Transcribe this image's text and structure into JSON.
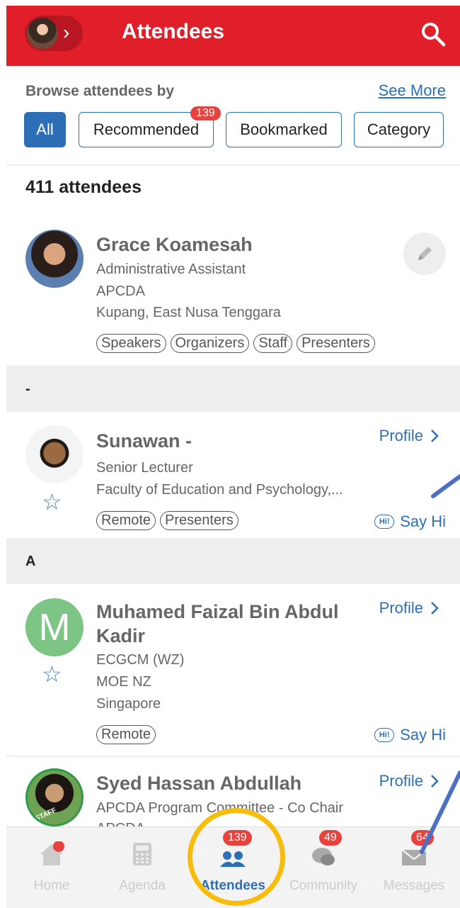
{
  "header": {
    "title": "Attendees"
  },
  "browse": {
    "label": "Browse attendees by",
    "see_more": "See More",
    "filters": [
      {
        "label": "All",
        "active": true
      },
      {
        "label": "Recommended",
        "badge": "139"
      },
      {
        "label": "Bookmarked"
      },
      {
        "label": "Category"
      }
    ]
  },
  "count_label": "411 attendees",
  "attendees": [
    {
      "name": "Grace Koamesah",
      "lines": [
        "Administrative Assistant",
        "APCDA",
        "Kupang, East Nusa Tenggara"
      ],
      "tags": [
        "Speakers",
        "Organizers",
        "Staff",
        "Presenters"
      ]
    },
    {
      "section": "-",
      "name": "Sunawan -",
      "lines": [
        "Senior Lecturer",
        "Faculty of Education and Psychology,..."
      ],
      "tags": [
        "Remote",
        "Presenters"
      ],
      "profile": "Profile",
      "say_hi": "Say Hi"
    },
    {
      "section": "A",
      "name_line1": "Muhamed Faizal Bin Abdul",
      "name_line2": "Kadir",
      "initial": "M",
      "lines": [
        "ECGCM (WZ)",
        "MOE NZ",
        "Singapore"
      ],
      "tags": [
        "Remote"
      ],
      "profile": "Profile",
      "say_hi": "Say Hi"
    },
    {
      "name": "Syed Hassan Abdullah",
      "lines": [
        "APCDA Program Committee - Co Chair",
        "APCDA"
      ],
      "photo_label": "STAFF",
      "profile": "Profile"
    }
  ],
  "hi_icon_text": "Hi!",
  "tabs": [
    {
      "label": "Home",
      "icon": "home-icon"
    },
    {
      "label": "Agenda",
      "icon": "calculator-icon"
    },
    {
      "label": "Attendees",
      "icon": "people-icon",
      "badge": "139",
      "active": true
    },
    {
      "label": "Community",
      "icon": "chat-icon",
      "badge": "49"
    },
    {
      "label": "Messages",
      "icon": "envelope-icon",
      "badge": "64"
    }
  ],
  "colors": {
    "brand_red": "#e01f2a",
    "link_blue": "#2c6fb7",
    "badge_red": "#e8423f",
    "annotation_yellow": "#f7bd0a",
    "annotation_blue": "#4a6fc4"
  }
}
